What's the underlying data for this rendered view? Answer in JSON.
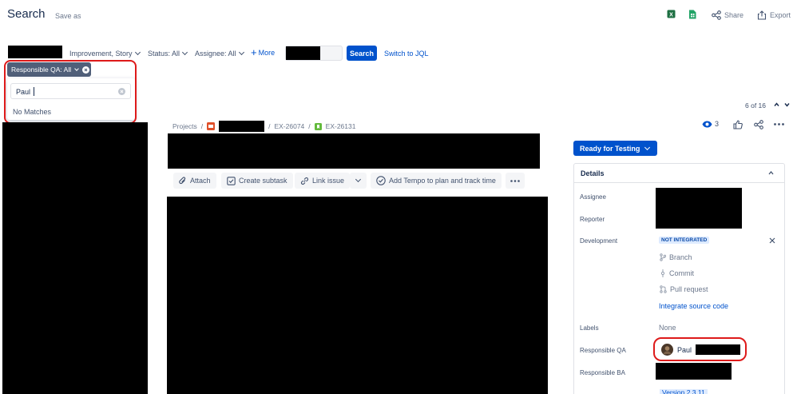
{
  "header": {
    "title": "Search",
    "save_as": "Save as",
    "share": "Share",
    "export": "Export",
    "excel_icon": "excel-icon",
    "sheet_icon": "spreadsheet-icon"
  },
  "filters": {
    "type": "Improvement, Story",
    "status": "Status: All",
    "assignee": "Assignee: All",
    "more": "More",
    "search_button": "Search",
    "switch_jql": "Switch to JQL",
    "responsible_qa": "Responsible QA: All"
  },
  "dropdown": {
    "search_value": "Paul",
    "empty_text": "No Matches"
  },
  "pagination": {
    "position": "6 of 16"
  },
  "breadcrumb": {
    "projects": "Projects",
    "parent": "EX-26074",
    "issue": "EX-26131"
  },
  "actions": {
    "attach": "Attach",
    "create_subtask": "Create subtask",
    "link_issue": "Link issue",
    "tempo": "Add Tempo to plan and track time"
  },
  "side": {
    "watchers": "3",
    "status": "Ready for Testing",
    "details_title": "Details",
    "assignee_label": "Assignee",
    "reporter_label": "Reporter",
    "development_label": "Development",
    "not_integrated": "NOT INTEGRATED",
    "branch": "Branch",
    "commit": "Commit",
    "pull_request": "Pull request",
    "integrate": "Integrate source code",
    "labels_label": "Labels",
    "labels_value": "None",
    "responsible_qa_label": "Responsible QA",
    "responsible_qa_value": "Paul",
    "responsible_ba_label": "Responsible BA",
    "version": "Version 2.3.11"
  },
  "colors": {
    "primary": "#0052cc",
    "highlight": "#de1a1a",
    "chip": "#505f79",
    "lozenge_bg": "#deebff"
  }
}
